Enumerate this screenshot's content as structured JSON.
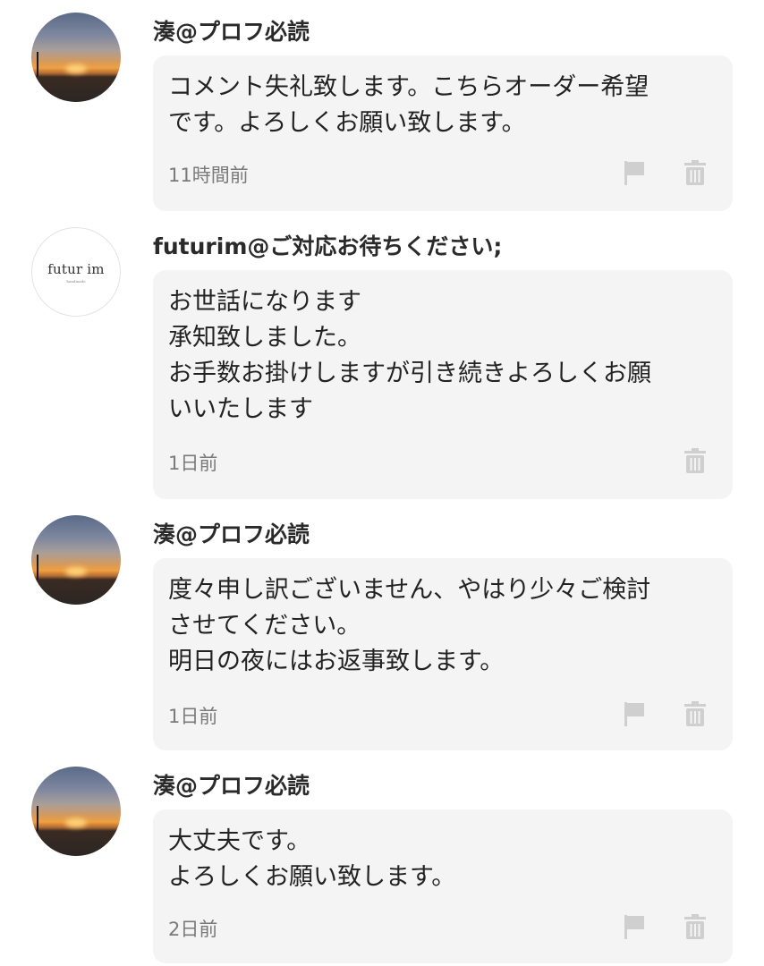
{
  "comments": [
    {
      "author": "湊@プロフ必読",
      "avatar": "sunset-photo",
      "message": "コメント失礼致します。こちらオーダー希望\nです。よろしくお願い致します。",
      "time": "11時間前",
      "icons": [
        "flag-icon",
        "trash-icon"
      ]
    },
    {
      "author": "futurim@ご対応お待ちください;",
      "avatar": "logo",
      "avatar_logo_text": "futur im",
      "message": "お世話になります\n承知致しました。\nお手数お掛けしますが引き続きよろしくお願\nいいたします",
      "time": "1日前",
      "icons": [
        "trash-icon"
      ]
    },
    {
      "author": "湊@プロフ必読",
      "avatar": "sunset-photo",
      "message": "度々申し訳ございません、やはり少々ご検討\nさせてください。\n明日の夜にはお返事致します。",
      "time": "1日前",
      "icons": [
        "flag-icon",
        "trash-icon"
      ]
    },
    {
      "author": "湊@プロフ必読",
      "avatar": "sunset-photo",
      "message": "大丈夫です。\nよろしくお願い致します。",
      "time": "2日前",
      "icons": [
        "flag-icon",
        "trash-icon"
      ]
    }
  ],
  "colors": {
    "bubble_bg": "#f4f4f4",
    "icon_gray": "#cfcfcf",
    "time_gray": "#7a7a7a"
  }
}
